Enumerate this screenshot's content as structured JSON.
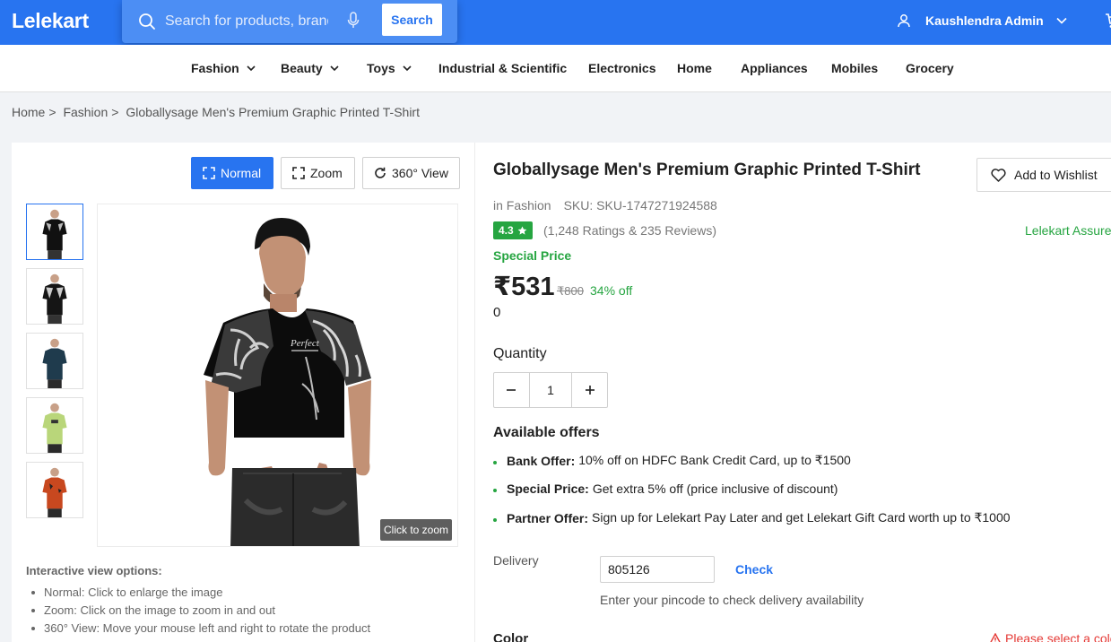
{
  "header": {
    "logo": "Lelekart",
    "search_placeholder": "Search for products, brands and more",
    "search_button": "Search",
    "user_name": "Kaushlendra Admin"
  },
  "categories": [
    {
      "label": "Fashion",
      "dropdown": true
    },
    {
      "label": "Beauty",
      "dropdown": true
    },
    {
      "label": "Toys",
      "dropdown": true
    },
    {
      "label": "Industrial & Scientific",
      "dropdown": false
    },
    {
      "label": "Electronics",
      "dropdown": false
    },
    {
      "label": "Home",
      "dropdown": false
    },
    {
      "label": "Appliances",
      "dropdown": false
    },
    {
      "label": "Mobiles",
      "dropdown": false
    },
    {
      "label": "Grocery",
      "dropdown": false
    }
  ],
  "breadcrumb": {
    "items": [
      "Home",
      "Fashion",
      "Globallysage Men's Premium Graphic Printed T-Shirt"
    ],
    "separator": ">"
  },
  "gallery": {
    "view_modes": [
      "Normal",
      "Zoom",
      "360° View"
    ],
    "active_mode": "Normal",
    "thumbnail_colors": [
      "#111111",
      "#151515",
      "#1f3b4d",
      "#b9d67a",
      "#c8481f"
    ],
    "selected_thumbnail": 0,
    "zoom_hint": "Click to zoom",
    "options_title": "Interactive view options:",
    "options": [
      "Normal: Click to enlarge the image",
      "Zoom: Click on the image to zoom in and out",
      "360° View: Move your mouse left and right to rotate the product"
    ]
  },
  "product": {
    "title": "Globallysage Men's Premium Graphic Printed T-Shirt",
    "wishlist_label": "Add to Wishlist",
    "category": "in Fashion",
    "sku": "SKU: SKU-1747271924588",
    "rating": "4.3",
    "rating_count": "(1,248 Ratings & 235 Reviews)",
    "assured": "Lelekart Assured",
    "special_label": "Special Price",
    "price": "₹531",
    "mrp": "₹800",
    "discount": "34% off",
    "extra_value": "0",
    "quantity_label": "Quantity",
    "quantity": "1"
  },
  "offers": {
    "title": "Available offers",
    "items": [
      {
        "type": "Bank Offer:",
        "text": "10% off on HDFC Bank Credit Card, up to ₹1500"
      },
      {
        "type": "Special Price:",
        "text": "Get extra 5% off (price inclusive of discount)"
      },
      {
        "type": "Partner Offer:",
        "text": "Sign up for Lelekart Pay Later and get Lelekart Gift Card worth up to ₹1000"
      }
    ]
  },
  "delivery": {
    "label": "Delivery",
    "pincode": "805126",
    "check_label": "Check",
    "hint": "Enter your pincode to check delivery availability"
  },
  "color_section": {
    "label": "Color",
    "warning": "Please select a color"
  },
  "colors": {
    "brand": "#2874f0",
    "success": "#26a541",
    "error": "#e53935"
  }
}
